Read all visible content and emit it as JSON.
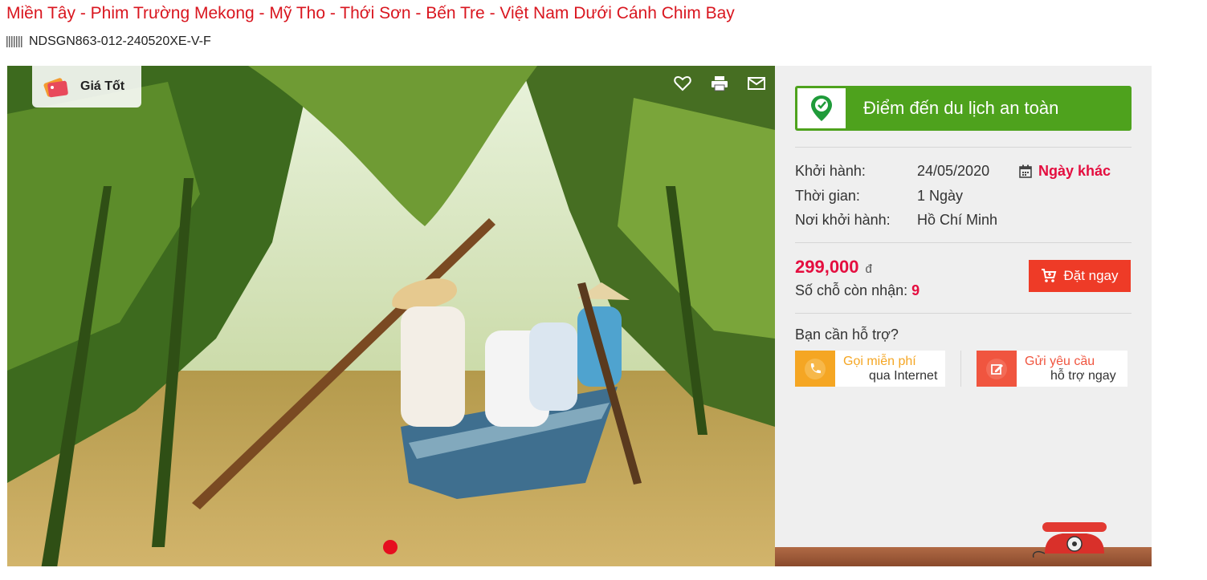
{
  "title": "Miền Tây - Phim Trường Mekong - Mỹ Tho - Thới Sơn - Bến Tre - Việt Nam Dưới Cánh Chim Bay",
  "tour_code": "NDSGN863-012-240520XE-V-F",
  "badge": {
    "label": "Giá Tốt",
    "icon": "tag-icon"
  },
  "photo_actions": [
    "heart-icon",
    "print-icon",
    "mail-icon"
  ],
  "safe_destination": {
    "label": "Điểm đến du lịch an toàn",
    "icon": "location-check-icon",
    "color": "#4ea21d"
  },
  "info": {
    "departure_label": "Khởi hành:",
    "departure_value": "24/05/2020",
    "other_dates": "Ngày khác",
    "duration_label": "Thời gian:",
    "duration_value": "1 Ngày",
    "origin_label": "Nơi khởi hành:",
    "origin_value": "Hồ Chí Minh"
  },
  "price": {
    "value": "299,000",
    "unit": "đ",
    "color": "#e40e3f"
  },
  "seats": {
    "label": "Số chỗ còn nhận:",
    "value": "9"
  },
  "book_button": {
    "label": "Đặt ngay",
    "color": "#ee3b27"
  },
  "support": {
    "title": "Bạn cần hỗ trợ?",
    "call_line1": "Gọi miễn phí",
    "call_line2": "qua Internet",
    "request_line1": "Gửi yêu cầu",
    "request_line2": "hỗ trợ ngay"
  }
}
